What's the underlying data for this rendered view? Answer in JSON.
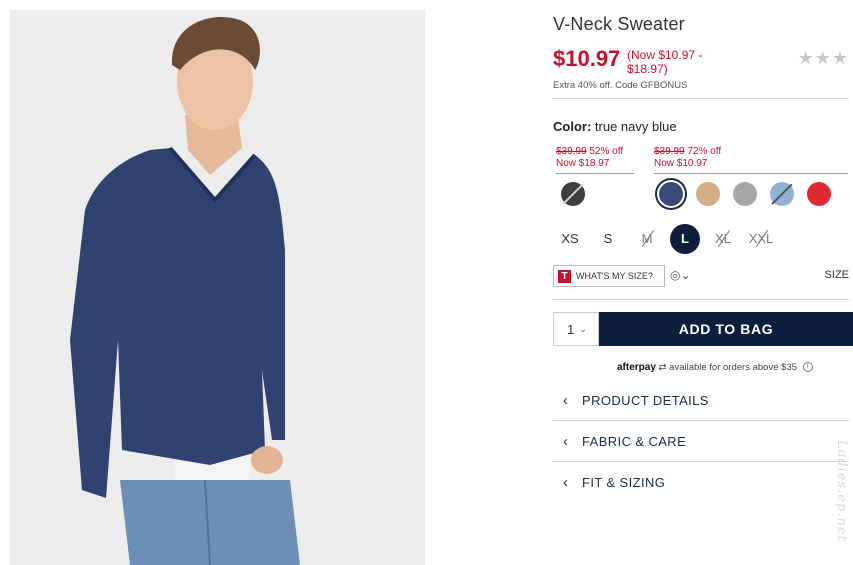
{
  "product": {
    "title": "V-Neck Sweater",
    "price": "$10.97",
    "price_range": "(Now $10.97 - $18.97)",
    "promo": "Extra 40% off. Code GFBONUS",
    "stars": "★★★"
  },
  "color": {
    "label": "Color:",
    "value": "true navy blue",
    "price_tags": [
      {
        "was": "$39.99",
        "discount": "52% off",
        "now": "Now $18.97"
      },
      {
        "was": "$39.99",
        "discount": "72% off",
        "now": "Now $10.97"
      }
    ],
    "swatches": [
      {
        "name": "charcoal",
        "hex": "#3e3e3e",
        "unavailable": true
      },
      {
        "name": "true navy blue",
        "hex": "#3a4b75",
        "selected": true
      },
      {
        "name": "khaki",
        "hex": "#d4ad84"
      },
      {
        "name": "grey",
        "hex": "#a6a6a6"
      },
      {
        "name": "light blue",
        "hex": "#93b1d3",
        "unavailable": true
      },
      {
        "name": "red",
        "hex": "#de2a2f"
      }
    ]
  },
  "sizes": {
    "options": [
      "XS",
      "S",
      "M",
      "L",
      "XL",
      "XXL"
    ],
    "selected": "L",
    "unavailable": [
      "M",
      "XL",
      "XXL"
    ]
  },
  "fit": {
    "whats_my_size": "WHAT'S MY SIZE?",
    "t_logo": "T",
    "size_label": "SIZE"
  },
  "cart": {
    "quantity": "1",
    "add_to_bag": "ADD TO BAG"
  },
  "afterpay": {
    "brand": "afterpay",
    "text": "available for orders above $35",
    "info": "i"
  },
  "accordion": [
    {
      "label": "PRODUCT DETAILS"
    },
    {
      "label": "FABRIC & CARE"
    },
    {
      "label": "FIT & SIZING"
    }
  ],
  "watermark": "Ladies.ep.net",
  "colors": {
    "sale_red": "#c8102e",
    "navy": "#0e1f3e"
  }
}
